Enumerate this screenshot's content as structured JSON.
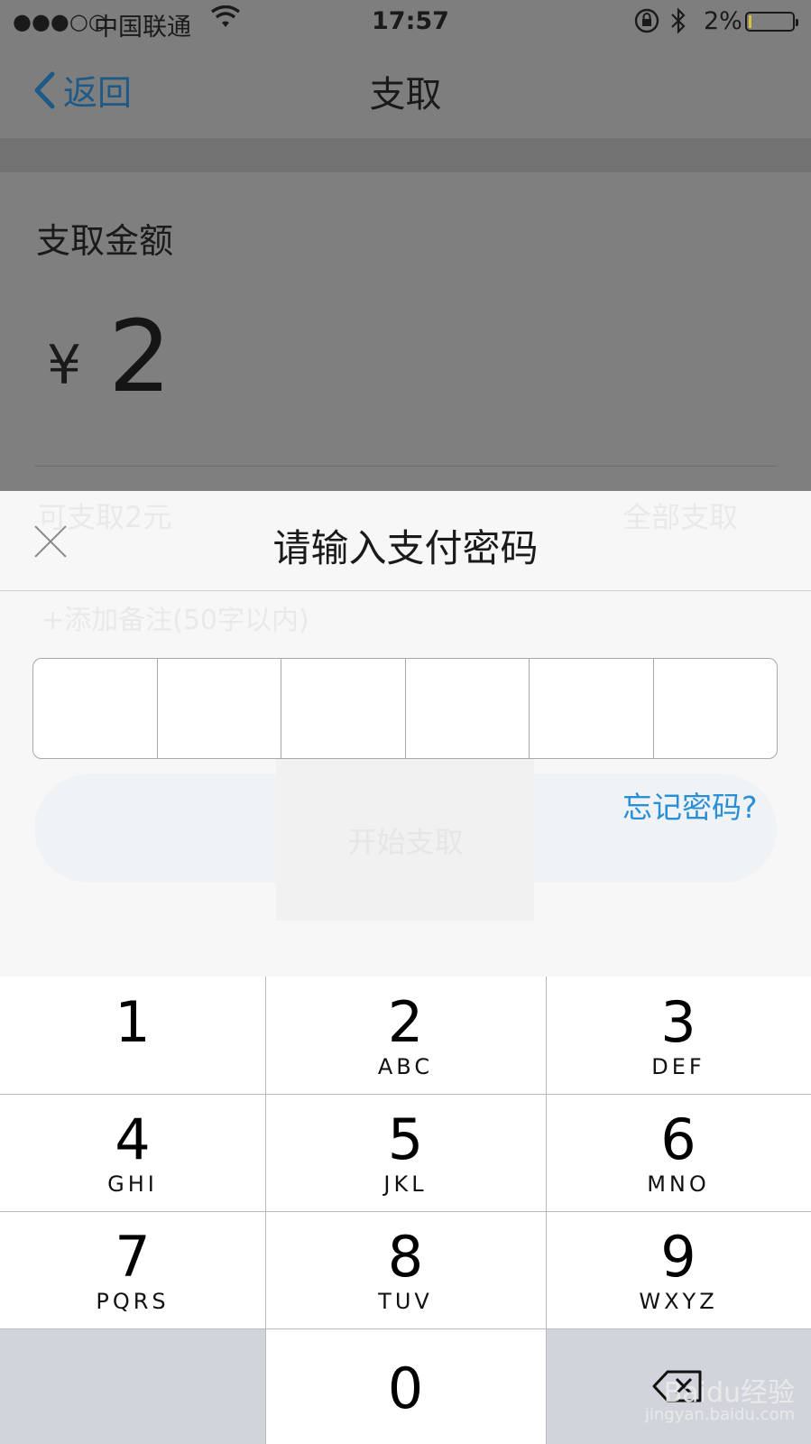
{
  "status_bar": {
    "signal": "●●●○○",
    "carrier": "中国联通",
    "wifi_icon": "wifi-icon",
    "time": "17:57",
    "battery_percent": "2%",
    "battery_level": 0.02
  },
  "nav": {
    "back_label": "返回",
    "title": "支取"
  },
  "form": {
    "amount_label": "支取金额",
    "currency": "¥",
    "amount": "2",
    "available_text": "可支取2元",
    "withdraw_all": "全部支取",
    "note_placeholder": "+添加备注(50字以内)",
    "submit_label": "开始支取"
  },
  "password_sheet": {
    "title": "请输入支付密码",
    "digits_count": 6,
    "forgot_label": "忘记密码?"
  },
  "keypad": {
    "keys": [
      {
        "digit": "1",
        "letters": ""
      },
      {
        "digit": "2",
        "letters": "ABC"
      },
      {
        "digit": "3",
        "letters": "DEF"
      },
      {
        "digit": "4",
        "letters": "GHI"
      },
      {
        "digit": "5",
        "letters": "JKL"
      },
      {
        "digit": "6",
        "letters": "MNO"
      },
      {
        "digit": "7",
        "letters": "PQRS"
      },
      {
        "digit": "8",
        "letters": "TUV"
      },
      {
        "digit": "9",
        "letters": "WXYZ"
      },
      {
        "digit": "0",
        "letters": ""
      }
    ]
  },
  "watermark": {
    "brand": "Baidu经验",
    "url": "jingyan.baidu.com"
  },
  "colors": {
    "link": "#2b8fd6",
    "back": "#1f5a86",
    "dim_overlay": "#7e7e7e"
  }
}
